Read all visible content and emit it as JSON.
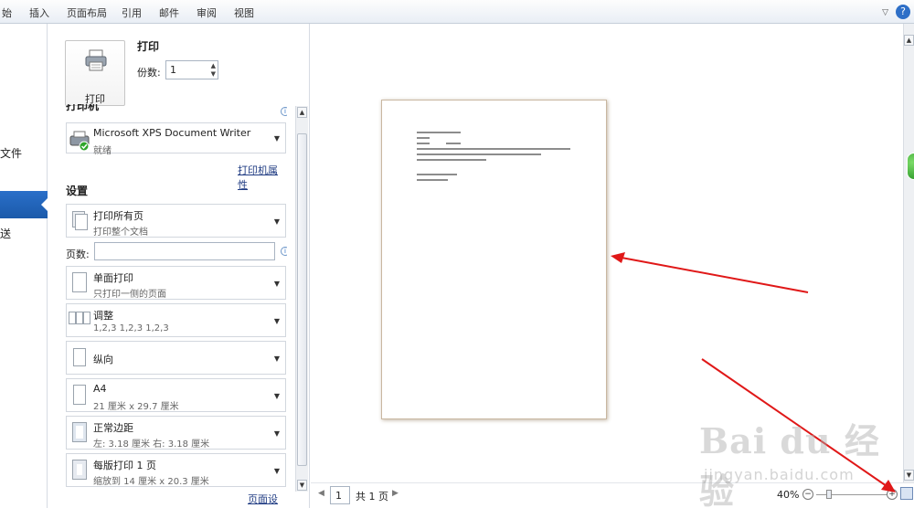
{
  "ribbon": {
    "tabs": [
      "始",
      "插入",
      "页面布局",
      "引用",
      "邮件",
      "审阅",
      "视图"
    ],
    "help_icon": "?"
  },
  "nav": {
    "items": [
      "文件",
      "送"
    ]
  },
  "print": {
    "button_label": "打印",
    "title": "打印",
    "copies_label": "份数:",
    "copies_value": "1"
  },
  "printer": {
    "section_title": "打印机",
    "name": "Microsoft XPS Document Writer",
    "status": "就绪",
    "properties_link": "打印机属性"
  },
  "settings": {
    "title": "设置",
    "pages_label": "页数:",
    "pages_value": "",
    "dropdowns": [
      {
        "title": "打印所有页",
        "subtitle": "打印整个文档"
      },
      {
        "title": "单面打印",
        "subtitle": "只打印一侧的页面"
      },
      {
        "title": "调整",
        "subtitle": "1,2,3    1,2,3    1,2,3"
      },
      {
        "title": "纵向",
        "subtitle": ""
      },
      {
        "title": "A4",
        "subtitle": "21 厘米 x 29.7 厘米"
      },
      {
        "title": "正常边距",
        "subtitle": "左: 3.18 厘米    右: 3.18 厘米"
      },
      {
        "title": "每版打印 1 页",
        "subtitle": "缩放到 14 厘米 x 20.3 厘米"
      }
    ],
    "page_setup_link": "页面设置"
  },
  "preview": {
    "page_number": "1",
    "page_total": "共 1 页",
    "zoom": "40%"
  },
  "icons": {
    "minus": "−",
    "plus": "+",
    "up": "▲",
    "down": "▼",
    "prev": "◀",
    "next": "▶"
  },
  "watermark": {
    "brand": "Bai du 经验",
    "url": "jingyan.baidu.com"
  },
  "colors": {
    "nav_selected": "#1f63b8",
    "arrow": "#e01818",
    "page_border": "#c9b7a1"
  }
}
